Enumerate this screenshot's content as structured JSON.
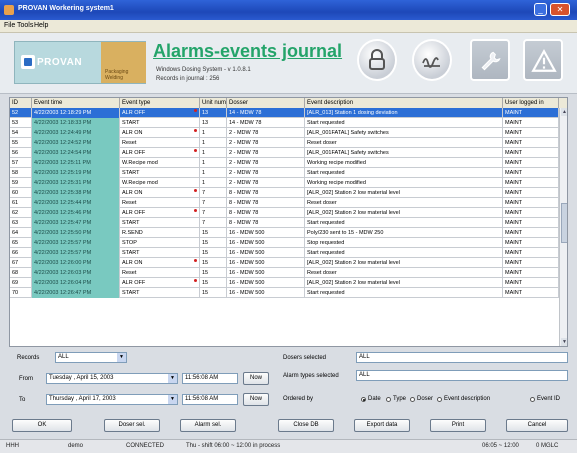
{
  "window": {
    "title": "PROVAN Workering system1"
  },
  "menu": [
    "File",
    "Tools",
    "Help"
  ],
  "header": {
    "logo_text": "PROVAN",
    "logo_sub": "Packaging Welding",
    "title": "Alarms-events journal",
    "subtitle1": "Windows Dosing System - v 1.0.8.1",
    "subtitle2": "Records in journal : 256",
    "icons": [
      "lock-icon",
      "signature-icon",
      "wrench-icon",
      "warning-icon"
    ]
  },
  "grid": {
    "columns": [
      "ID",
      "Event time",
      "Event type",
      "Unit num",
      "Dosser",
      "Event description",
      "User logged in"
    ],
    "rows": [
      {
        "id": "52",
        "time": "4/22/2003 12:18:29 PM",
        "type": "ALR OFF",
        "flag": true,
        "unit": "13",
        "doser": "14 - MDW 78",
        "desc": "[ALR_013] Station 1 dosing deviation",
        "user": "MAINT",
        "selected": true
      },
      {
        "id": "53",
        "time": "4/22/2003 12:18:33 PM",
        "type": "START",
        "flag": false,
        "unit": "13",
        "doser": "14 - MDW 78",
        "desc": "Start requested",
        "user": "MAINT"
      },
      {
        "id": "54",
        "time": "4/22/2003 12:24:49 PM",
        "type": "ALR ON",
        "flag": true,
        "unit": "1",
        "doser": "2 - MDW 78",
        "desc": "[ALR_001FATAL] Safety switches",
        "user": "MAINT"
      },
      {
        "id": "55",
        "time": "4/22/2003 12:24:52 PM",
        "type": "Reset",
        "flag": false,
        "unit": "1",
        "doser": "2 - MDW 78",
        "desc": "Reset doser",
        "user": "MAINT"
      },
      {
        "id": "56",
        "time": "4/22/2003 12:24:54 PM",
        "type": "ALR OFF",
        "flag": true,
        "unit": "1",
        "doser": "2 - MDW 78",
        "desc": "[ALR_001FATAL] Safety switches",
        "user": "MAINT"
      },
      {
        "id": "57",
        "time": "4/22/2003 12:25:11 PM",
        "type": "W.Recipe mod",
        "flag": false,
        "unit": "1",
        "doser": "2 - MDW 78",
        "desc": "Working recipe modified",
        "user": "MAINT"
      },
      {
        "id": "58",
        "time": "4/22/2003 12:25:19 PM",
        "type": "START",
        "flag": false,
        "unit": "1",
        "doser": "2 - MDW 78",
        "desc": "Start requested",
        "user": "MAINT"
      },
      {
        "id": "59",
        "time": "4/22/2003 12:25:31 PM",
        "type": "W.Recipe mod",
        "flag": false,
        "unit": "1",
        "doser": "2 - MDW 78",
        "desc": "Working recipe modified",
        "user": "MAINT"
      },
      {
        "id": "60",
        "time": "4/22/2003 12:25:38 PM",
        "type": "ALR ON",
        "flag": true,
        "unit": "7",
        "doser": "8 - MDW 78",
        "desc": "[ALR_002] Station 2 low material level",
        "user": "MAINT"
      },
      {
        "id": "61",
        "time": "4/22/2003 12:25:44 PM",
        "type": "Reset",
        "flag": false,
        "unit": "7",
        "doser": "8 - MDW 78",
        "desc": "Reset doser",
        "user": "MAINT"
      },
      {
        "id": "62",
        "time": "4/22/2003 12:25:46 PM",
        "type": "ALR OFF",
        "flag": true,
        "unit": "7",
        "doser": "8 - MDW 78",
        "desc": "[ALR_002] Station 2 low material level",
        "user": "MAINT"
      },
      {
        "id": "63",
        "time": "4/22/2003 12:25:47 PM",
        "type": "START",
        "flag": false,
        "unit": "7",
        "doser": "8 - MDW 78",
        "desc": "Start requested",
        "user": "MAINT"
      },
      {
        "id": "64",
        "time": "4/22/2003 12:25:50 PM",
        "type": "R.SEND",
        "flag": false,
        "unit": "15",
        "doser": "16 - MDW 500",
        "desc": "Poly/230     sent to 15 - MDW 250",
        "user": "MAINT"
      },
      {
        "id": "65",
        "time": "4/22/2003 12:25:57 PM",
        "type": "STOP",
        "flag": false,
        "unit": "15",
        "doser": "16 - MDW 500",
        "desc": "Stop requested",
        "user": "MAINT"
      },
      {
        "id": "66",
        "time": "4/22/2003 12:25:57 PM",
        "type": "START",
        "flag": false,
        "unit": "15",
        "doser": "16 - MDW 500",
        "desc": "Start requested",
        "user": "MAINT"
      },
      {
        "id": "67",
        "time": "4/22/2003 12:26:00 PM",
        "type": "ALR ON",
        "flag": true,
        "unit": "15",
        "doser": "16 - MDW 500",
        "desc": "[ALR_002] Station 2 low material level",
        "user": "MAINT"
      },
      {
        "id": "68",
        "time": "4/22/2003 12:26:03 PM",
        "type": "Reset",
        "flag": false,
        "unit": "15",
        "doser": "16 - MDW 500",
        "desc": "Reset doser",
        "user": "MAINT"
      },
      {
        "id": "69",
        "time": "4/22/2003 12:26:04 PM",
        "type": "ALR OFF",
        "flag": true,
        "unit": "15",
        "doser": "16 - MDW 500",
        "desc": "[ALR_002] Station 2 low material level",
        "user": "MAINT"
      },
      {
        "id": "70",
        "time": "4/22/2003 12:26:47 PM",
        "type": "START",
        "flag": false,
        "unit": "15",
        "doser": "16 - MDW 500",
        "desc": "Start requested",
        "user": "MAINT"
      }
    ]
  },
  "filters": {
    "records_label": "Records",
    "records_value": "ALL",
    "from_label": "From",
    "from_date": "Tuesday , April 15, 2003",
    "from_time": "11:56:08 AM",
    "to_label": "To",
    "to_date": "Thursday , April 17, 2003",
    "to_time": "11:56:08 AM",
    "now_label": "Now",
    "dosers_label": "Dosers selected",
    "dosers_value": "ALL",
    "alarm_types_label": "Alarm types selected",
    "alarm_types_value": "ALL",
    "ordered_by_label": "Ordered by",
    "order_options": [
      "Date",
      "Type",
      "Doser",
      "Event description",
      "Event ID"
    ],
    "order_selected": "Date"
  },
  "buttons": {
    "ok": "OK",
    "doser_sel": "Doser sel.",
    "alarm_sel": "Alarm sel.",
    "close_db": "Close DB",
    "export": "Export data",
    "print": "Print",
    "cancel": "Cancel"
  },
  "status": {
    "left": "HHH",
    "user": "demo",
    "conn": "CONNECTED",
    "shift": "Thu - shift 06:00 ~ 12:00 in process",
    "time": "06:05 ~ 12:00",
    "code": "0 MGLC"
  }
}
